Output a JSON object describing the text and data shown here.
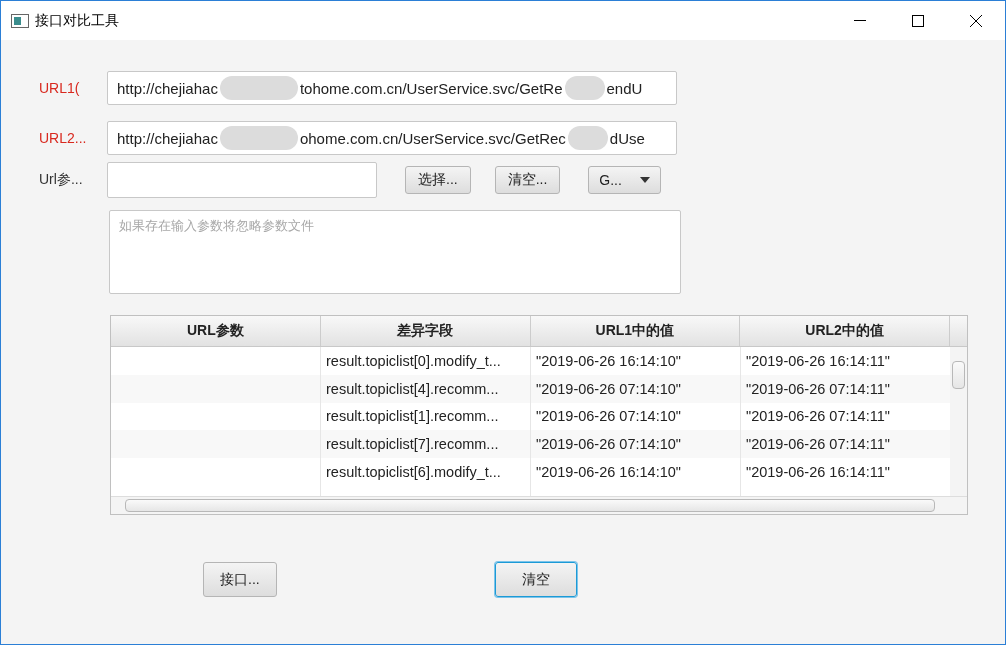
{
  "window": {
    "title": "接口对比工具"
  },
  "url_rows": [
    {
      "label": "URL1(",
      "segments": [
        "http://chejiahac",
        "tohome.com.cn/UserService.svc/GetRe",
        "endU"
      ]
    },
    {
      "label": "URL2...",
      "segments": [
        "http://chejiahac",
        "ohome.com.cn/UserService.svc/GetRec",
        "dUse"
      ]
    }
  ],
  "param_row": {
    "label": "Url参...",
    "buttons": [
      "选择...",
      "清空..."
    ],
    "dropdown": "G..."
  },
  "params_area": {
    "placeholder": "如果存在输入参数将忽略参数文件"
  },
  "table": {
    "columns": [
      "URL参数",
      "差异字段",
      "URL1中的值",
      "URL2中的值"
    ],
    "rows": [
      [
        "",
        "result.topiclist[0].modify_t...",
        "\"2019-06-26 16:14:10\"",
        "\"2019-06-26 16:14:11\""
      ],
      [
        "",
        "result.topiclist[4].recomm...",
        "\"2019-06-26 07:14:10\"",
        "\"2019-06-26 07:14:11\""
      ],
      [
        "",
        "result.topiclist[1].recomm...",
        "\"2019-06-26 07:14:10\"",
        "\"2019-06-26 07:14:11\""
      ],
      [
        "",
        "result.topiclist[7].recomm...",
        "\"2019-06-26 07:14:10\"",
        "\"2019-06-26 07:14:11\""
      ],
      [
        "",
        "result.topiclist[6].modify_t...",
        "\"2019-06-26 16:14:10\"",
        "\"2019-06-26 16:14:11\""
      ]
    ]
  },
  "bottom_buttons": [
    {
      "label": "接口...",
      "focused": false
    },
    {
      "label": "清空",
      "focused": true
    }
  ]
}
